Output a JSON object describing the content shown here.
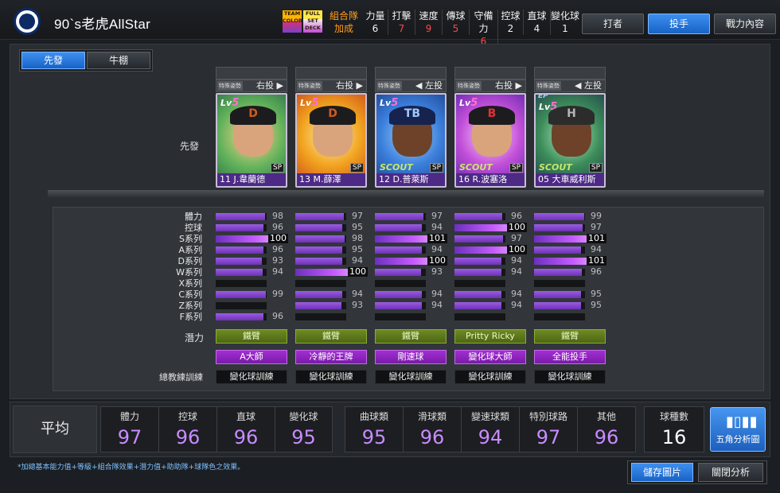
{
  "header": {
    "team_name": "90`s老虎AllStar",
    "badge_team": "TEAM COLOR",
    "badge_full": "FULL SET DECK",
    "combo_top": "組合隊",
    "combo_bottom": "加成",
    "stats": [
      {
        "label": "力量",
        "value": "6",
        "color": "white"
      },
      {
        "label": "打擊",
        "value": "7",
        "color": "red"
      },
      {
        "label": "速度",
        "value": "9",
        "color": "red"
      },
      {
        "label": "傳球",
        "value": "5",
        "color": "red"
      },
      {
        "label": "守備力",
        "value": "6",
        "color": "red"
      },
      {
        "label": "控球",
        "value": "2",
        "color": "white"
      },
      {
        "label": "直球",
        "value": "4",
        "color": "white"
      },
      {
        "label": "變化球",
        "value": "1",
        "color": "white"
      }
    ],
    "tabs": [
      {
        "label": "打者",
        "active": false
      },
      {
        "label": "投手",
        "active": true
      },
      {
        "label": "戰力內容",
        "active": false
      }
    ]
  },
  "subtabs": [
    {
      "label": "先發",
      "active": true
    },
    {
      "label": "牛棚",
      "active": false
    }
  ],
  "row_label_starter": "先發",
  "pitchers": [
    {
      "tag": "特殊姿勢",
      "hand": "右投 ▶",
      "lv": "Lv",
      "lv_num": "5",
      "cap_letter": "D",
      "skin": "light",
      "cap": "black",
      "scout": "",
      "ep": "",
      "name": "11 J.韋蘭德",
      "card_bg": "#2b6b4a"
    },
    {
      "tag": "特殊姿勢",
      "hand": "右投 ▶",
      "lv": "Lv",
      "lv_num": "5",
      "cap_letter": "D",
      "skin": "light",
      "cap": "black",
      "scout": "",
      "ep": "",
      "name": "13 M.薛澤",
      "card_bg": "#e9a51c"
    },
    {
      "tag": "特殊姿勢",
      "hand": "◀ 左投",
      "lv": "Lv",
      "lv_num": "5",
      "cap_letter": "TB",
      "skin": "dark",
      "cap": "navy",
      "scout": "SCOUT",
      "ep": "",
      "name": "12 D.普萊斯",
      "card_bg": "#1f5fc2"
    },
    {
      "tag": "特殊姿勢",
      "hand": "右投 ▶",
      "lv": "Lv",
      "lv_num": "5",
      "cap_letter": "B",
      "skin": "light",
      "cap": "black",
      "scout": "SCOUT",
      "ep": "",
      "name": "16 R.波塞洛",
      "card_bg": "#7a3fd6"
    },
    {
      "tag": "特殊姿勢",
      "hand": "◀ 左投",
      "lv": "Lv",
      "lv_num": "5",
      "cap_letter": "H",
      "skin": "dark",
      "cap": "gray",
      "scout": "SCOUT",
      "ep": "EP",
      "name": "05 大車威利斯",
      "card_bg": "#2c3a52"
    }
  ],
  "stat_rows": [
    "體力",
    "控球",
    "S系列",
    "A系列",
    "D系列",
    "W系列",
    "X系列",
    "C系列",
    "Z系列",
    "F系列"
  ],
  "stat_values": [
    [
      "98",
      "96",
      "100",
      "96",
      "93",
      "94",
      "",
      "99",
      "",
      "96"
    ],
    [
      "97",
      "95",
      "98",
      "95",
      "94",
      "100",
      "",
      "94",
      "93",
      ""
    ],
    [
      "97",
      "94",
      "101",
      "94",
      "100",
      "93",
      "",
      "94",
      "94",
      ""
    ],
    [
      "96",
      "100",
      "97",
      "100",
      "94",
      "94",
      "",
      "94",
      "94",
      ""
    ],
    [
      "99",
      "97",
      "101",
      "94",
      "101",
      "96",
      "",
      "95",
      "95",
      ""
    ]
  ],
  "potential_label": "潛力",
  "potentials": [
    "鐵臂",
    "鐵臂",
    "鐵臂",
    "Pritty Ricky",
    "鐵臂"
  ],
  "specials": [
    "A大師",
    "冷靜的王牌",
    "剛速球",
    "變化球大師",
    "全能投手"
  ],
  "coach_label": "總教練訓練",
  "coach": [
    "變化球訓練",
    "變化球訓練",
    "變化球訓練",
    "變化球訓練",
    "變化球訓練"
  ],
  "summary": {
    "avg_label": "平均",
    "group1": [
      {
        "label": "體力",
        "value": "97"
      },
      {
        "label": "控球",
        "value": "96"
      },
      {
        "label": "直球",
        "value": "96"
      },
      {
        "label": "變化球",
        "value": "95"
      }
    ],
    "group2": [
      {
        "label": "曲球類",
        "value": "95"
      },
      {
        "label": "滑球類",
        "value": "96"
      },
      {
        "label": "變速球類",
        "value": "94"
      },
      {
        "label": "特別球路",
        "value": "97"
      },
      {
        "label": "其他",
        "value": "96"
      }
    ],
    "count_label": "球種數",
    "count_value": "16",
    "radar_label": "五角分析圖"
  },
  "footnote": "*加總基本能力值+等級+組合隊效果+潛力值+助助隊+球隊色之效果。",
  "bottom_buttons": [
    {
      "label": "儲存圖片",
      "active": true
    },
    {
      "label": "關閉分析",
      "active": false
    }
  ],
  "colors": {
    "accent_blue": "#2a7be0",
    "stat_purple": "#c98bff",
    "bar_purple": "#8a4fd8",
    "highlight_red": "#ff4747",
    "combo_orange": "#ff9d1a"
  }
}
